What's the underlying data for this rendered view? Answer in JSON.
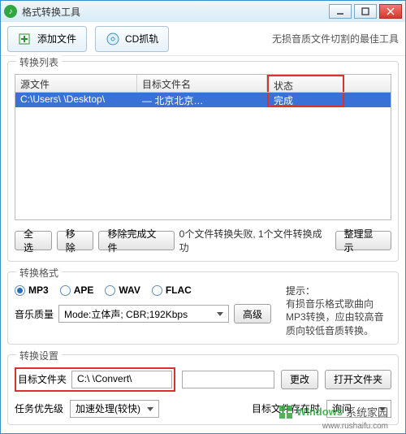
{
  "title": "格式转换工具",
  "toolbar": {
    "add_file": "添加文件",
    "cd_grab": "CD抓轨"
  },
  "tagline": "无损音质文件切割的最佳工具",
  "list": {
    "group": "转换列表",
    "cols": {
      "src": "源文件",
      "dst": "目标文件名",
      "status": "状态"
    },
    "rows": [
      {
        "src": "C:\\Users\\    \\Desktop\\",
        "dst": "      — 北京北京…",
        "status": "完成"
      }
    ],
    "actions": {
      "select_all": "全选",
      "remove": "移除",
      "remove_done": "移除完成文件",
      "align": "整理显示"
    },
    "status_text": "0个文件转换失败, 1个文件转换成功"
  },
  "format": {
    "group": "转换格式",
    "options": [
      "MP3",
      "APE",
      "WAV",
      "FLAC"
    ],
    "selected": "MP3",
    "hint_title": "提示：",
    "hint_body": "有损音乐格式歌曲向MP3转换，应由较高音质向较低音质转换。",
    "quality_label": "音乐质量",
    "quality_value": "Mode:立体声; CBR;192Kbps",
    "advanced": "高级"
  },
  "settings": {
    "group": "转换设置",
    "target_label": "目标文件夹",
    "target_value": "C:\\     \\Convert\\",
    "change": "更改",
    "open_folder": "打开文件夹",
    "priority_label": "任务优先级",
    "priority_value": "加速处理(较快)",
    "exists_label": "目标文件存在时",
    "exists_value": "询问"
  },
  "watermark": {
    "brand1": "Windows",
    "brand2": "系统家园",
    "url": "www.rushaifu.com"
  }
}
